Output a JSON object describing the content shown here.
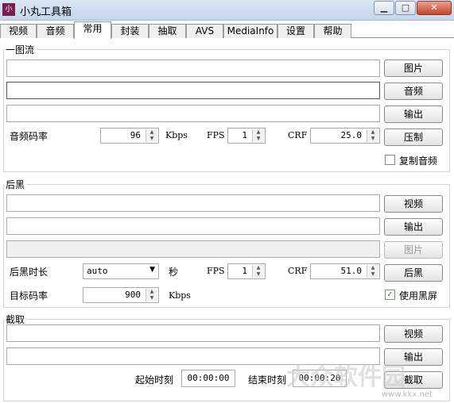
{
  "window": {
    "title": "小丸工具箱",
    "icon_text": "小"
  },
  "tabs": [
    "视频",
    "音频",
    "常用",
    "封装",
    "抽取",
    "AVS",
    "MediaInfo",
    "设置",
    "帮助"
  ],
  "active_tab": "常用",
  "one_image": {
    "group_label": "一图流",
    "btn_image": "图片",
    "btn_audio": "音频",
    "btn_output": "输出",
    "btn_encode": "压制",
    "audio_bitrate_label": "音频码率",
    "audio_bitrate_value": "96",
    "kbps_unit": "Kbps",
    "fps_label": "FPS",
    "fps_value": "1",
    "crf_label": "CRF",
    "crf_value": "25.0",
    "copy_audio_label": "复制音频",
    "copy_audio_checked": false
  },
  "black_tail": {
    "group_label": "后黑",
    "btn_video": "视频",
    "btn_output": "输出",
    "btn_image": "图片",
    "btn_tail": "后黑",
    "duration_label": "后黑时长",
    "duration_value": "auto",
    "sec_unit": "秒",
    "fps_label": "FPS",
    "fps_value": "1",
    "crf_label": "CRF",
    "crf_value": "51.0",
    "target_bitrate_label": "目标码率",
    "target_bitrate_value": "900",
    "kbps_unit": "Kbps",
    "use_black_label": "使用黑屏",
    "use_black_checked": true
  },
  "clip": {
    "group_label": "截取",
    "btn_video": "视频",
    "btn_output": "输出",
    "btn_clip": "截取",
    "start_label": "起始时刻",
    "start_value": "00:00:00",
    "end_label": "结束时刻",
    "end_value": "00:00:20"
  },
  "watermark": {
    "text": "大众软件园",
    "url": "www.kkx.net"
  }
}
